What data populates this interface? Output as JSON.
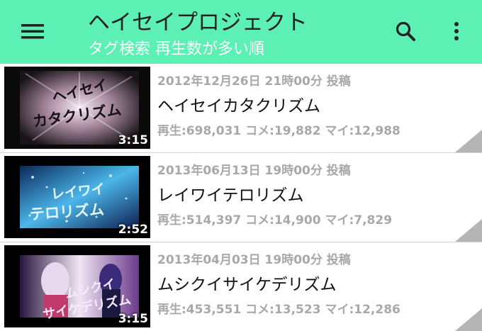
{
  "toolbar": {
    "title": "ヘイセイプロジェクト",
    "subtitle": "タグ検索 再生数が多い順",
    "menu_icon": "hamburger-menu-icon",
    "search_icon": "search-icon",
    "more_icon": "more-vert-icon",
    "bg_color": "#5cf0b4"
  },
  "videos": [
    {
      "date": "2012年12月26日 21時00分 投稿",
      "title": "ヘイセイカタクリズム",
      "stats": "再生:698,031 コメ:19,882 マイ:12,988",
      "duration": "3:15",
      "thumb_text_1": "ヘイセイ",
      "thumb_text_2": "カタクリズム"
    },
    {
      "date": "2013年06月13日 19時00分 投稿",
      "title": "レイワイテロリズム",
      "stats": "再生:514,397 コメ:14,900 マイ:7,829",
      "duration": "2:52",
      "thumb_text_1": "レイワイ",
      "thumb_text_2": "テロリズム"
    },
    {
      "date": "2013年04月03日 19時00分 投稿",
      "title": "ムシクイサイケデリズム",
      "stats": "再生:453,551 コメ:13,523 マイ:12,286",
      "duration": "3:15",
      "thumb_text_1": "ムシクイ",
      "thumb_text_2": "サイケデリズム"
    }
  ]
}
